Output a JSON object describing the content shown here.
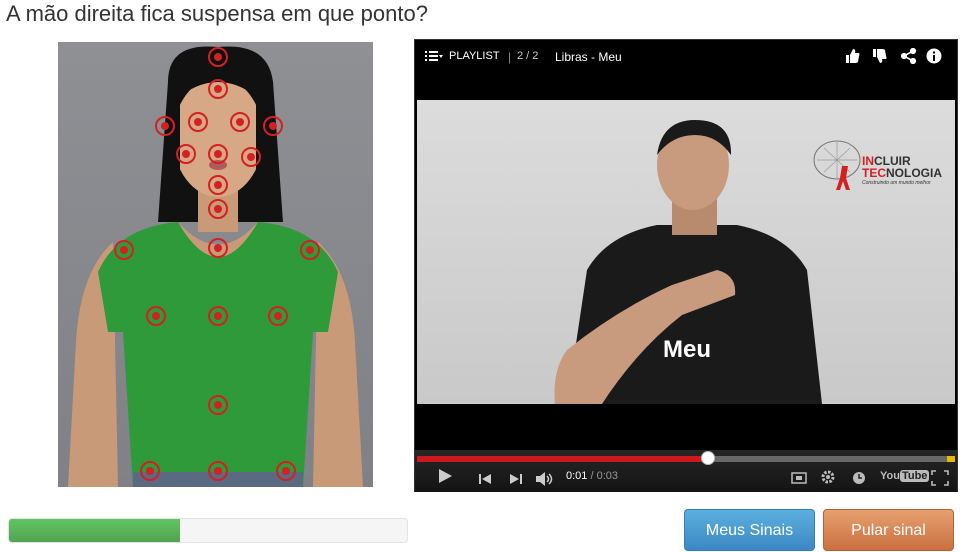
{
  "question": "A mão direita fica suspensa em que ponto?",
  "video": {
    "playlist_label": "PLAYLIST",
    "playlist_position": "2 / 2",
    "video_title": "Libras - Meu",
    "sign_caption": "Meu",
    "logo_line1_red": "IN",
    "logo_line1_dark": "CLUIR",
    "logo_line2_red": "TEC",
    "logo_line2_dark": "NOLOGIA",
    "logo_tagline": "Construindo um mundo melhor",
    "current_time": "0:01",
    "time_separator": " / ",
    "duration": "0:03",
    "youtube_label": "YouTube",
    "progress": 0.54
  },
  "progress_bar": {
    "value": 0.43
  },
  "buttons": {
    "meus_sinais": "Meus Sinais",
    "pular_sinal": "Pular sinal"
  },
  "colors": {
    "accent_red": "#cc181e",
    "green": "#5cb85c",
    "blue_button": "#428bca",
    "orange_button": "#d4804f"
  }
}
